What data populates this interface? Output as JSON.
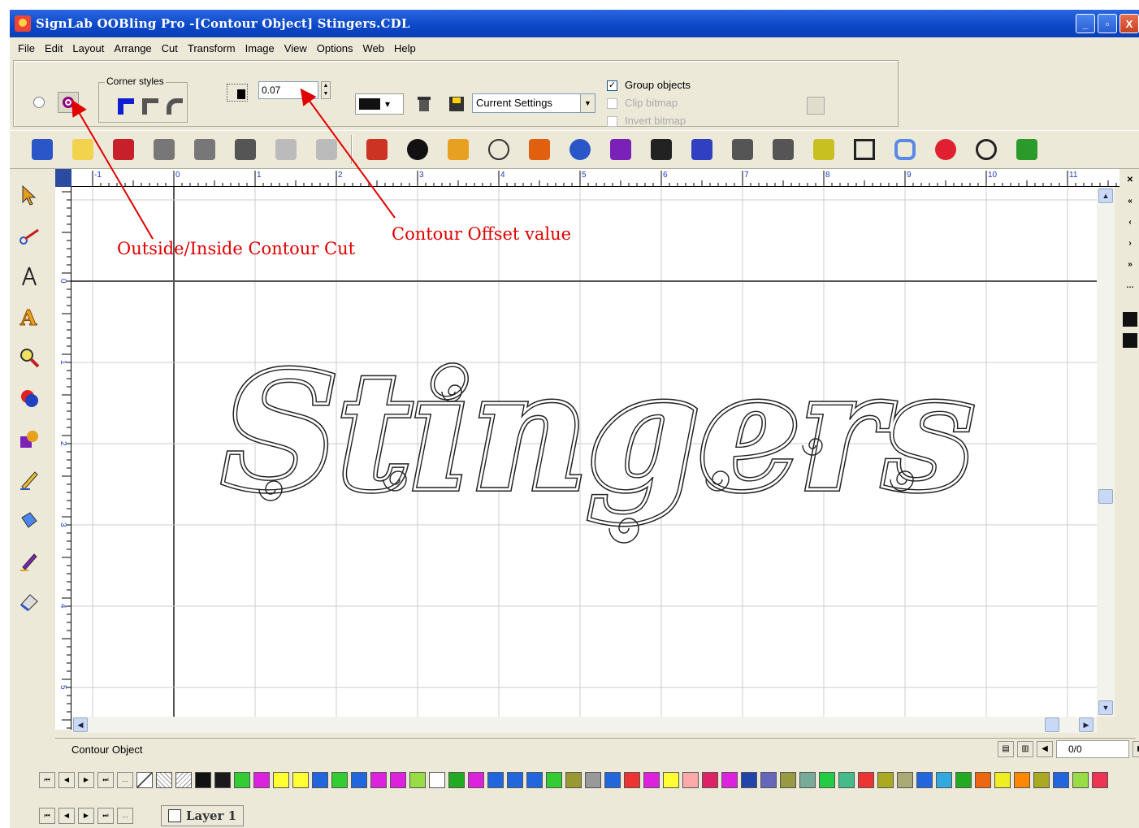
{
  "window": {
    "title": "SignLab OOBling Pro -[Contour Object] Stingers.CDL",
    "controls": [
      "_",
      "▫",
      "X"
    ]
  },
  "menu": [
    {
      "label": "File"
    },
    {
      "label": "Edit"
    },
    {
      "label": "Layout"
    },
    {
      "label": "Arrange"
    },
    {
      "label": "Cut"
    },
    {
      "label": "Transform"
    },
    {
      "label": "Image"
    },
    {
      "label": "View"
    },
    {
      "label": "Options"
    },
    {
      "label": "Web"
    },
    {
      "label": "Help"
    }
  ],
  "property_bar": {
    "corner_styles_label": "Corner styles",
    "contour_offset_value": "0.07",
    "settings_select": "Current Settings",
    "group_objects_label": "Group objects",
    "clip_bitmap_label": "Clip bitmap",
    "invert_bitmap_label": "Invert bitmap",
    "group_objects_checked": true,
    "clip_bitmap_checked": false,
    "invert_bitmap_checked": false
  },
  "ruler": {
    "top_labels": [
      "-1",
      "0",
      "1",
      "2",
      "3",
      "4",
      "5",
      "6",
      "7",
      "8",
      "9",
      "10",
      "11"
    ],
    "left_labels": [
      "0",
      "1",
      "2",
      "3",
      "4",
      "5"
    ]
  },
  "canvas": {
    "artwork_text": "Stingers"
  },
  "annotations": {
    "contour_cut": "Outside/Inside Contour Cut",
    "offset_value": "Contour Offset value"
  },
  "status": {
    "text": "Contour Object",
    "page_indicator": "0/0"
  },
  "colors": {
    "accent_annotation": "#e00000",
    "title_bar": "#0b47c7",
    "swatches": [
      "#111111",
      "#1a1a1a",
      "#33cc33",
      "#dd22dd",
      "#ffff33",
      "#ffff33",
      "#2266dd",
      "#33cc33",
      "#2266dd",
      "#dd22dd",
      "#dd22dd",
      "#99dd44",
      "#ffffff",
      "#22aa22",
      "#dd22dd",
      "#2266dd",
      "#2266dd",
      "#2266dd",
      "#33cc33",
      "#999933",
      "#999999",
      "#2266dd",
      "#ee3333",
      "#dd22dd",
      "#ffff33",
      "#ffaaaa",
      "#dd2266",
      "#dd22dd",
      "#2244aa",
      "#6666bb",
      "#999944",
      "#77aa99",
      "#22cc44",
      "#44bb88",
      "#ee3333",
      "#aaaa22",
      "#aaaa77",
      "#2266dd",
      "#33aadd",
      "#22aa22",
      "#ee6611",
      "#eeee22",
      "#ff8800",
      "#aaaa22",
      "#2266dd",
      "#99dd44",
      "#ee3355"
    ]
  },
  "layer": {
    "label": "Layer 1"
  }
}
